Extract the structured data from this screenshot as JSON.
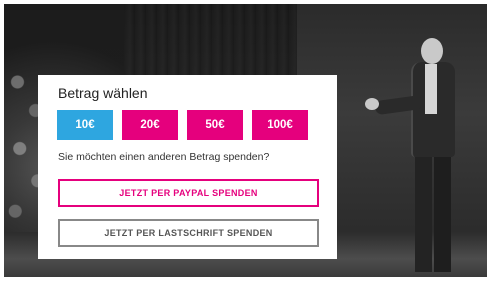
{
  "panel": {
    "title": "Betrag wählen",
    "amounts": [
      {
        "label": "10€",
        "selected": true
      },
      {
        "label": "20€",
        "selected": false
      },
      {
        "label": "50€",
        "selected": false
      },
      {
        "label": "100€",
        "selected": false
      }
    ],
    "other_amount_text": "Sie möchten einen anderen Betrag spenden?",
    "paypal_button": "JETZT PER PAYPAL SPENDEN",
    "lastschrift_button": "JETZT PER LASTSCHRIFT SPENDEN"
  },
  "colors": {
    "accent_magenta": "#e5007d",
    "selected_blue": "#2ea6e0",
    "secondary_border": "#888888"
  }
}
